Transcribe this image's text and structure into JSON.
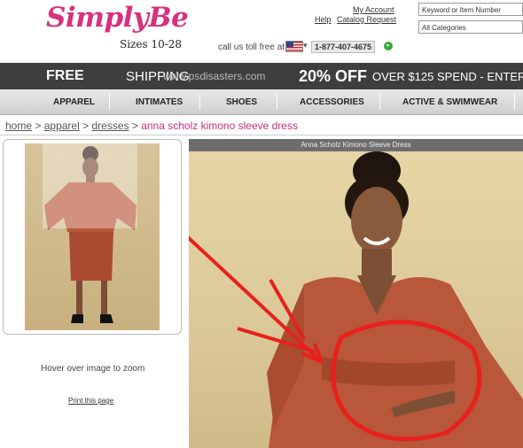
{
  "header": {
    "logo_text": "SimplyBe",
    "sizes": "Sizes 10-28",
    "my_account": "My Account",
    "help": "Help",
    "catalog_request": "Catalog Request",
    "toll_free": "call us toll free at",
    "phone": "1-877-407-4675",
    "search_placeholder": "Keyword or Item Number",
    "category_select": "All Categories"
  },
  "promo": {
    "free": "FREE",
    "shipping": "SHIPPING",
    "url": "www.psdisasters.com",
    "discount": "20% OFF",
    "rest": "OVER $125 SPEND - ENTER"
  },
  "nav": {
    "items": [
      "APPAREL",
      "INTIMATES",
      "SHOES",
      "ACCESSORIES",
      "ACTIVE & SWIMWEAR"
    ]
  },
  "breadcrumb": {
    "home": "home",
    "apparel": "apparel",
    "dresses": "dresses",
    "current": "anna scholz kimono sleeve dress",
    "sep": ">"
  },
  "product": {
    "image_title": "Anna Scholz Kimono Sleeve Dress",
    "hover_text": "Hover over image to zoom",
    "print_link": "Print this page"
  },
  "colors": {
    "brand_pink": "#d6317f",
    "promo_bg": "#3e3e3e",
    "dress": "#b9573a",
    "annotation_red": "#e8201c"
  }
}
